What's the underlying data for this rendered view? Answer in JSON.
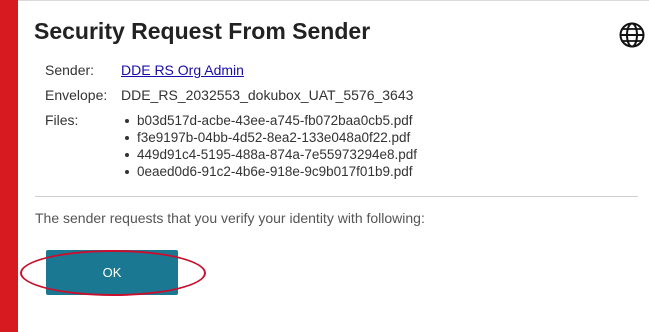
{
  "dialog": {
    "title": "Security Request From Sender",
    "globe_icon": "globe-icon",
    "sender_label": "Sender:",
    "sender_value": "DDE RS Org Admin",
    "envelope_label": "Envelope:",
    "envelope_value": "DDE_RS_2032553_dokubox_UAT_5576_3643",
    "files_label": "Files:",
    "files": [
      "b03d517d-acbe-43ee-a745-fb072baa0cb5.pdf",
      "f3e9197b-04bb-4d52-8ea2-133e048a0f22.pdf",
      "449d91c4-5195-488a-874a-7e55973294e8.pdf",
      "0eaed0d6-91c2-4b6e-918e-9c9b017f01b9.pdf"
    ],
    "message": "The sender requests that you verify your identity with following:",
    "ok_label": "OK"
  },
  "colors": {
    "accent_bar": "#d71920",
    "button": "#1b7893",
    "highlight": "#c8102e",
    "link": "#1a0dab"
  }
}
